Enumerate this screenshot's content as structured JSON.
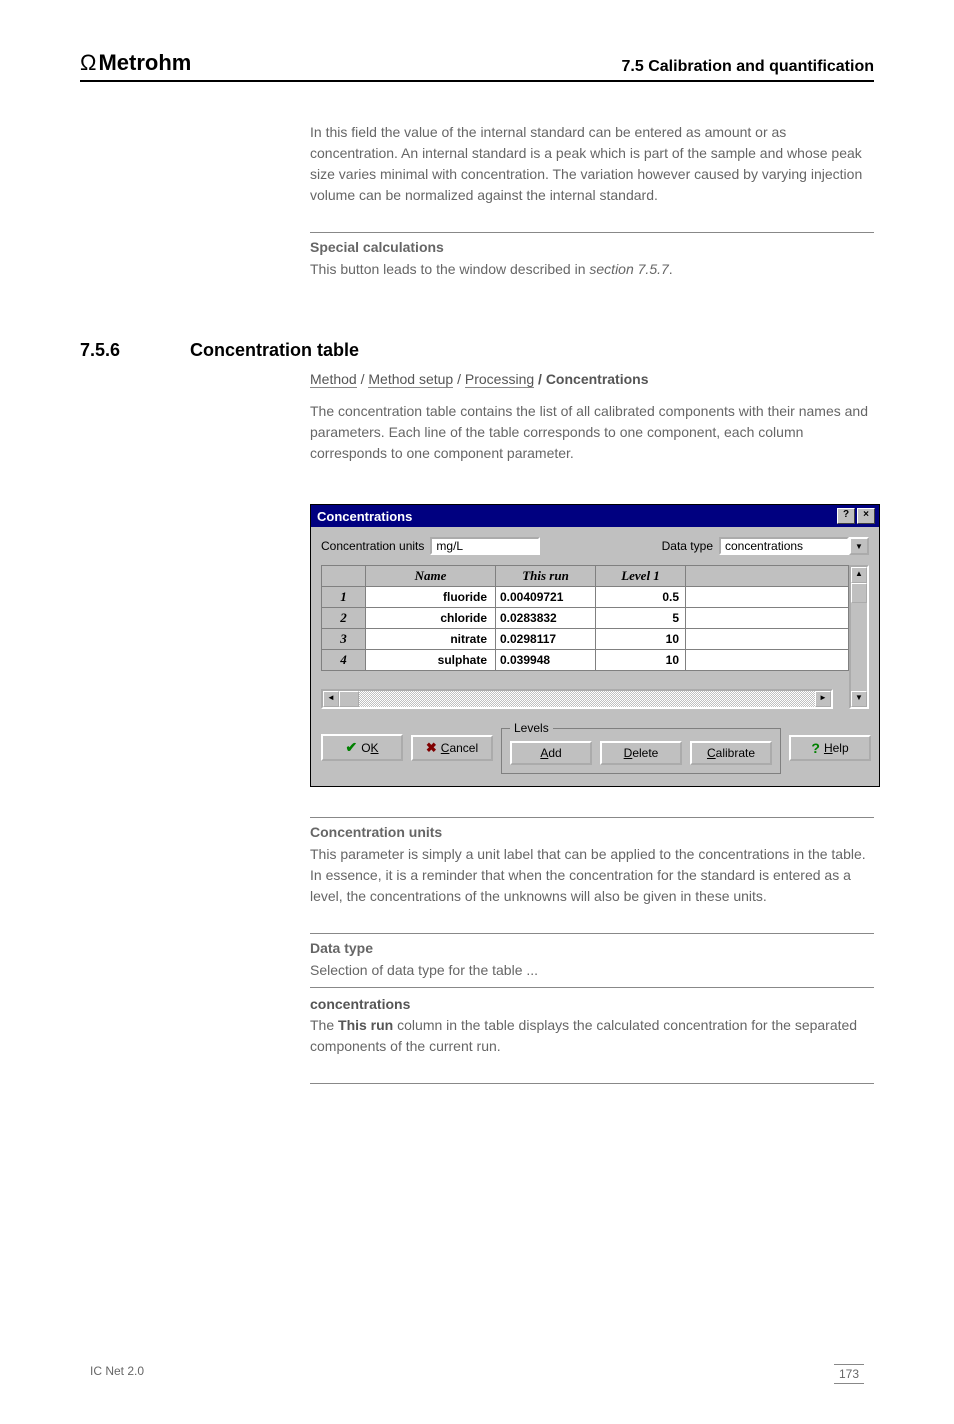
{
  "header": {
    "brand": "Metrohm",
    "section_ref": "7.5  Calibration and quantification"
  },
  "pretext": {
    "p1": "In this field the value of the internal standard can be entered as amount or as concentration. An internal standard is a peak which is part of the sample and whose peak size varies minimal with concentration. The variation however caused by varying injection volume can be normalized against the internal standard.",
    "sub1": "Special calculations",
    "p2_a": "This button leads to the window described in ",
    "p2_b": "section 7.5.7",
    "p2_c": "."
  },
  "section": {
    "num": "7.5.6",
    "title": "Concentration table"
  },
  "menu_path": {
    "a": "Method",
    "b": "Method setup",
    "c": "Processing",
    "d": " / Concentrations"
  },
  "intro": "The concentration table contains the list of all calibrated components with their names and parameters. Each line of the table corresponds to one component, each column corresponds to one component parameter.",
  "dialog": {
    "title": "Concentrations",
    "conc_units_label": "Concentration units",
    "conc_units_value": "mg/L",
    "data_type_label": "Data type",
    "data_type_value": "concentrations",
    "columns": [
      "Name",
      "This run",
      "Level 1"
    ],
    "rows": [
      {
        "idx": "1",
        "name": "fluoride",
        "thisrun": "0.00409721",
        "lvl": "0.5"
      },
      {
        "idx": "2",
        "name": "chloride",
        "thisrun": "0.0283832",
        "lvl": "5"
      },
      {
        "idx": "3",
        "name": "nitrate",
        "thisrun": "0.0298117",
        "lvl": "10"
      },
      {
        "idx": "4",
        "name": "sulphate",
        "thisrun": "0.039948",
        "lvl": "10"
      }
    ],
    "levels_legend": "Levels",
    "buttons": {
      "ok": "OK",
      "cancel": "Cancel",
      "add": "Add",
      "delete": "Delete",
      "calibrate": "Calibrate",
      "help": "Help"
    }
  },
  "posttext": {
    "sub1": "Concentration units",
    "p1": "This parameter is simply a unit label that can be applied to the concentrations in the table. In essence, it is a reminder that when the concentration for the standard is entered as a level, the concentrations of the unknowns will also be given in these units.",
    "sub2": "Data type",
    "p2": "Selection of data type for the table ...",
    "opt1": "concentrations",
    "p3a": "The ",
    "p3b": "This run",
    "p3c": " column in the table displays the calculated concentration for the separated components of the current run."
  },
  "footer": {
    "left": "IC Net 2.0",
    "page": "173"
  }
}
